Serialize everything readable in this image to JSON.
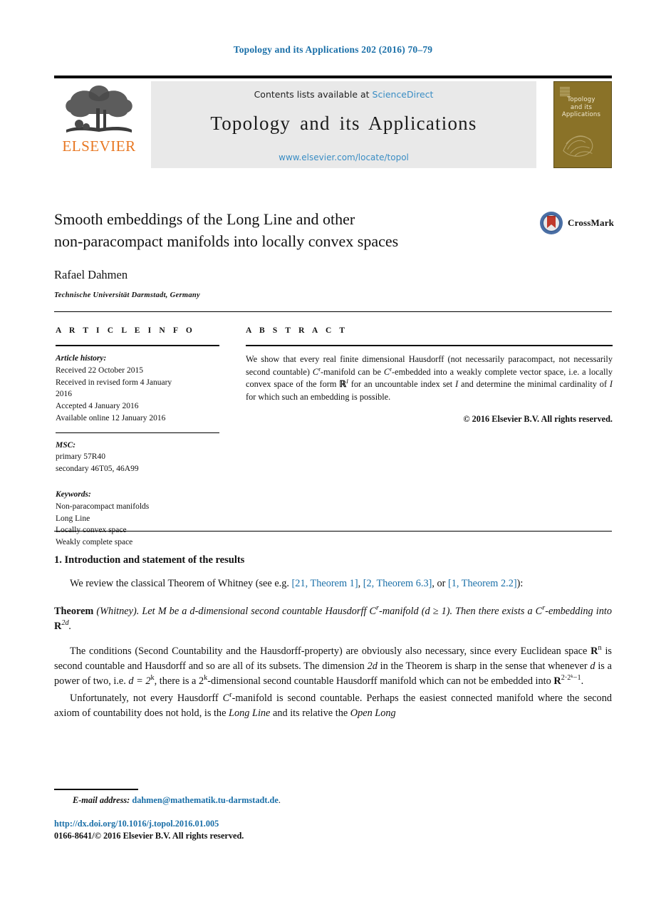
{
  "running_head": "Topology and its Applications 202 (2016) 70–79",
  "masthead": {
    "contents_prefix": "Contents lists available at ",
    "sciencedirect": "ScienceDirect",
    "journal_name": "Topology and its Applications",
    "journal_url": "www.elsevier.com/locate/topol",
    "publisher_wordmark": "ELSEVIER",
    "cover_title_line1": "Topology",
    "cover_title_line2": "and its",
    "cover_title_line3": "Applications"
  },
  "article": {
    "title_line1": "Smooth embeddings of the Long Line and other",
    "title_line2": "non-paracompact manifolds into locally convex spaces",
    "author": "Rafael Dahmen",
    "affiliation": "Technische Universität Darmstadt, Germany",
    "crossmark_label": "CrossMark"
  },
  "info": {
    "heading": "A R T I C L E   I N F O",
    "history_label": "Article history:",
    "history": [
      "Received 22 October 2015",
      "Received in revised form 4 January",
      "2016",
      "Accepted 4 January 2016",
      "Available online 12 January 2016"
    ],
    "msc_label": "MSC:",
    "msc": [
      "primary 57R40",
      "secondary 46T05, 46A99"
    ],
    "keywords_label": "Keywords:",
    "keywords": [
      "Non-paracompact manifolds",
      "Long Line",
      "Locally convex space",
      "Weakly complete space"
    ]
  },
  "abstract": {
    "heading": "A B S T R A C T",
    "text_part1": "We show that every real finite dimensional Hausdorff (not necessarily paracompact, not necessarily second countable) ",
    "cr1": "C",
    "cr1_sup": "r",
    "text_part2": "-manifold can be ",
    "cr2": "C",
    "cr2_sup": "r",
    "text_part3": "-embedded into a weakly complete vector space, i.e. a locally convex space of the form ",
    "rspace": "ℝ",
    "rspace_sup": "I",
    "text_part4": " for an uncountable index set ",
    "iset": "I",
    "text_part5": " and determine the minimal cardinality of ",
    "iset2": "I",
    "text_part6": " for which such an embedding is possible.",
    "copyright": "© 2016 Elsevier B.V. All rights reserved."
  },
  "body": {
    "section_title": "1. Introduction and statement of the results",
    "p1_a": "We review the classical Theorem of Whitney (see e.g. ",
    "ref1": "[21, Theorem 1]",
    "p1_b": ", ",
    "ref2": "[2, Theorem 6.3]",
    "p1_c": ", or ",
    "ref3": "[1, Theorem 2.2]",
    "p1_d": "):",
    "thm_label": "Theorem",
    "thm_attrib": " (Whitney). ",
    "thm_a": "Let ",
    "thm_M": "M",
    "thm_b": " be a d-dimensional second countable Hausdorff ",
    "thm_C": "C",
    "thm_C_sup": "r",
    "thm_c": "-manifold (d ≥ 1). Then there exists a ",
    "thm_C2": "C",
    "thm_C2_sup": "r",
    "thm_d": "-embedding into ",
    "thm_R": "R",
    "thm_R_sup": "2d",
    "thm_e": ".",
    "p2_a": "The conditions (Second Countability and the Hausdorff-property) are obviously also necessary, since every Euclidean space ",
    "p2_R": "R",
    "p2_R_sup": "n",
    "p2_b": " is second countable and Hausdorff and so are all of its subsets. The dimension ",
    "p2_2d": "2d",
    "p2_c": " in the Theorem is sharp in the sense that whenever ",
    "p2_d": "d",
    "p2_e": " is a power of two, i.e. ",
    "p2_f": "d = 2",
    "p2_f_sup": "k",
    "p2_g": ", there is a 2",
    "p2_g_sup": "k",
    "p2_h": "-dimensional second countable Hausdorff manifold which can not be embedded into ",
    "p2_R2": "R",
    "p2_R2_sup": "2·2ᵏ−1",
    "p2_i": ".",
    "p3_a": "Unfortunately, not every Hausdorff ",
    "p3_C": "C",
    "p3_C_sup": "r",
    "p3_b": "-manifold is second countable. Perhaps the easiest connected manifold where the second axiom of countability does not hold, is the ",
    "p3_ll": "Long Line",
    "p3_c": " and its relative the ",
    "p3_oll": "Open Long"
  },
  "footer": {
    "email_label": "E-mail address:",
    "email": "dahmen@mathematik.tu-darmstadt.de",
    "email_period": ".",
    "doi": "http://dx.doi.org/10.1016/j.topol.2016.01.005",
    "issn_line": "0166-8641/© 2016 Elsevier B.V. All rights reserved."
  },
  "colors": {
    "link": "#1a6fa8",
    "sciencedirect": "#3a8dc4",
    "elsevier_orange": "#e87722",
    "cover_bg": "#8a7228",
    "banner_bg": "#e9e9e9"
  }
}
